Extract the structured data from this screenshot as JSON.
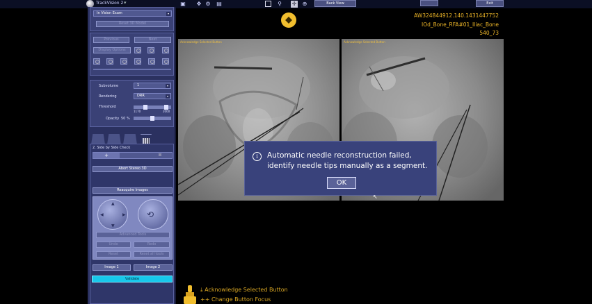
{
  "topbar": {
    "app_name": "TrackVision 2",
    "back_view_label": "Back View",
    "exit_label": "Exit"
  },
  "left_panel": {
    "exam_select": "In Vision Exam",
    "reset_button": "Reset 3D Model",
    "prev_button": "Previous",
    "next_button": "Next",
    "display_button": "Display Options",
    "subvolume_label": "Subvolume",
    "subvolume_value": "1",
    "rendering_label": "Rendering",
    "rendering_value": "DRR",
    "threshold_label": "Threshold",
    "threshold_min": "1170",
    "threshold_max": "2000",
    "opacity_label": "Opacity",
    "opacity_value": "50 %",
    "section_title": "2. Side by Side Check",
    "abort_button": "Abort Stereo 3D",
    "reacquire_button": "Reacquire Images",
    "advanced_button": "Advanced Tools",
    "undo_button": "Undo",
    "redo_button": "Redo",
    "reset_view_button": "Reset",
    "reset_all_button": "Reset all tools",
    "image1_button": "Image 1",
    "image2_button": "Image 2",
    "validate_button": "Validate"
  },
  "info": {
    "line1": "AW324844912.140.1431447752",
    "line2": "IOd_Bone_RFA#01_Iliac_Bone",
    "line3": "540_73"
  },
  "viewports": {
    "left_caption": "Acknowledge Selected Button",
    "right_caption": "Acknowledge Selected Button"
  },
  "dialog": {
    "icon": "info-icon",
    "line1": "Automatic needle reconstruction failed,",
    "line2": "identify needle tips manually as a segment.",
    "ok_label": "OK"
  },
  "hints": {
    "line1": "Acknowledge Selected Button",
    "line2": "Change Button Focus",
    "line1_prefix": "⤓",
    "line2_prefix": "++"
  },
  "colors": {
    "accent": "#f0b828",
    "panel": "#2b3160",
    "validate": "#17c8ea"
  }
}
